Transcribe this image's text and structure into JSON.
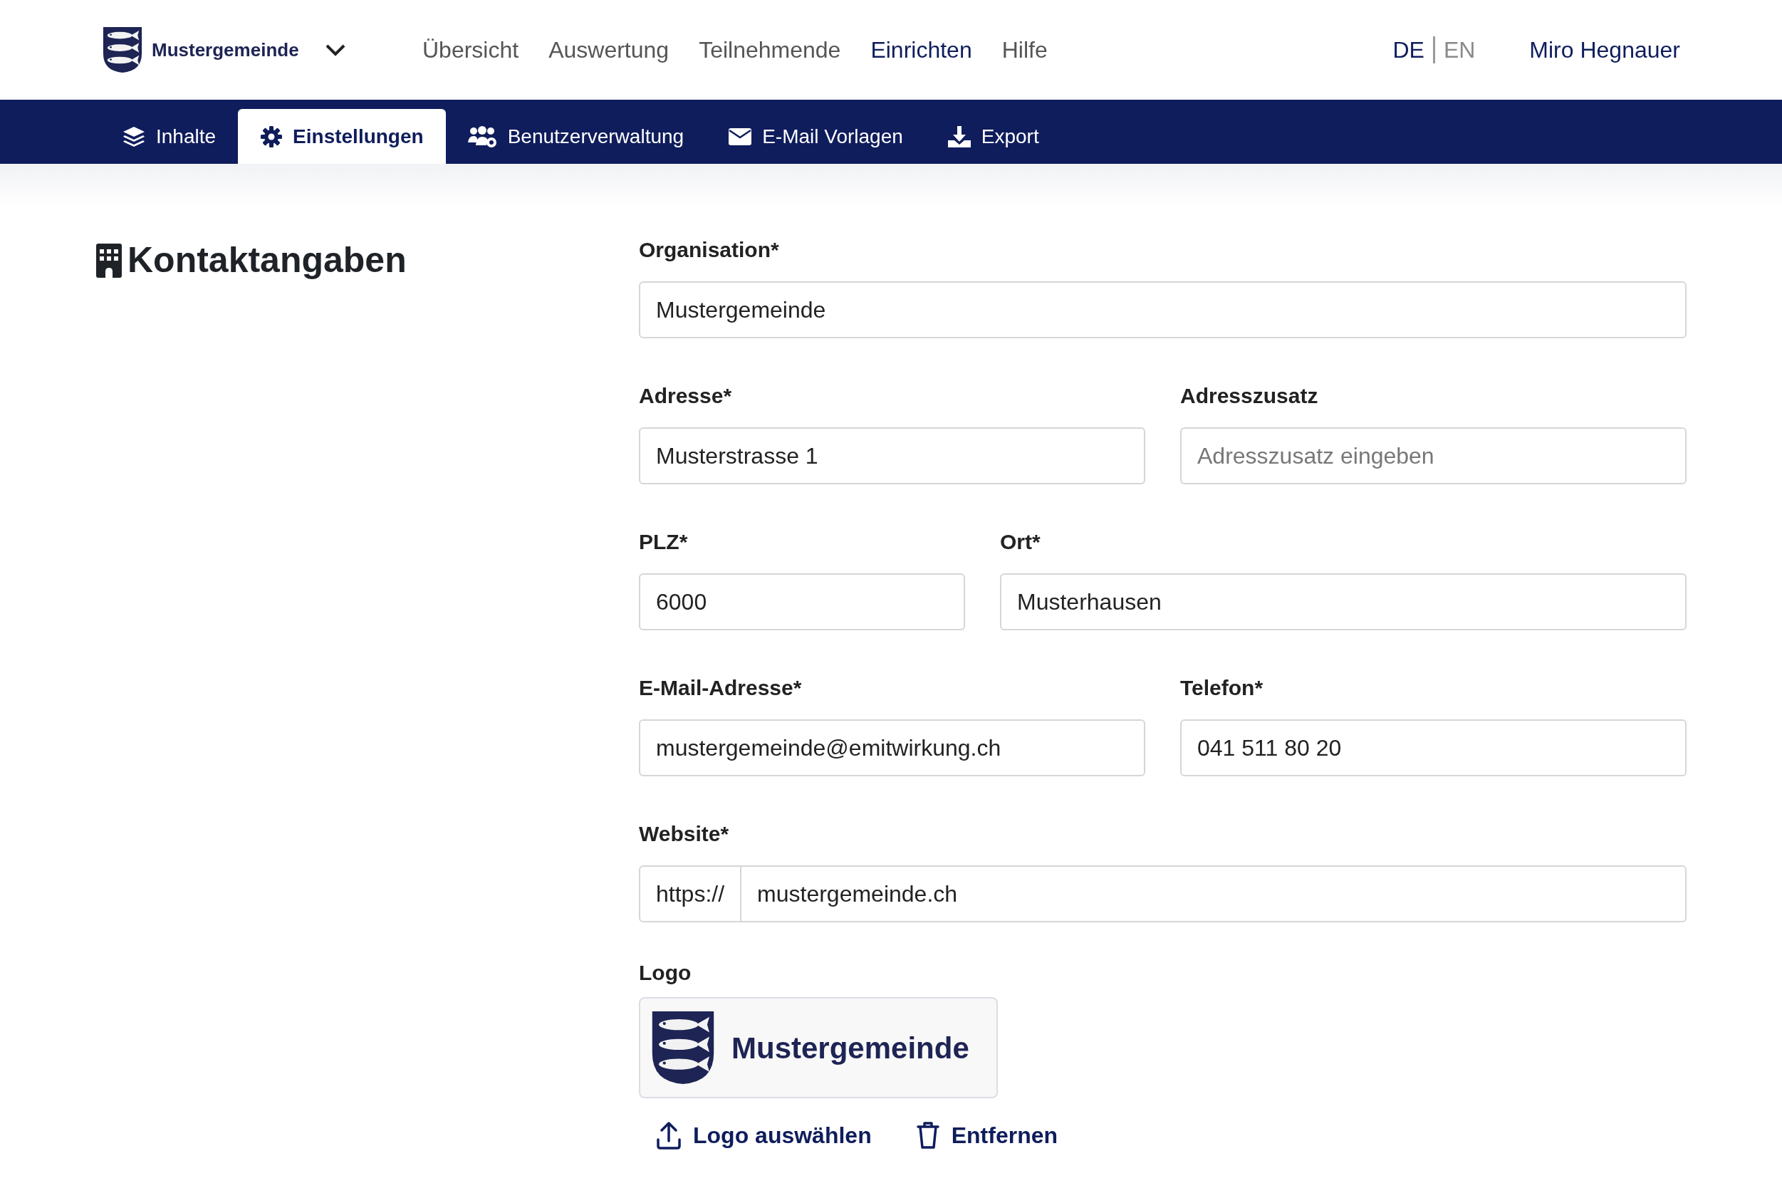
{
  "header": {
    "logo_text": "Mustergemeinde",
    "nav": [
      {
        "label": "Übersicht",
        "selected": false
      },
      {
        "label": "Auswertung",
        "selected": false
      },
      {
        "label": "Teilnehmende",
        "selected": false
      },
      {
        "label": "Einrichten",
        "selected": true
      },
      {
        "label": "Hilfe",
        "selected": false
      }
    ],
    "languages": [
      {
        "label": "DE",
        "selected": true
      },
      {
        "label": "EN",
        "selected": false
      }
    ],
    "user": "Miro Hegnauer"
  },
  "tabs": [
    {
      "label": "Inhalte",
      "selected": false
    },
    {
      "label": "Einstellungen",
      "selected": true
    },
    {
      "label": "Benutzerverwaltung",
      "selected": false
    },
    {
      "label": "E-Mail Vorlagen",
      "selected": false
    },
    {
      "label": "Export",
      "selected": false
    }
  ],
  "section": {
    "title": "Kontaktangaben"
  },
  "form_rows": [
    {
      "kind": "full",
      "fields": [
        {
          "label": "Organisation*",
          "value": "Mustergemeinde"
        }
      ]
    },
    {
      "kind": "halves",
      "fields": [
        {
          "label": "Adresse*",
          "value": "Musterstrasse 1"
        },
        {
          "label": "Adresszusatz",
          "placeholder": "Adresszusatz eingeben"
        }
      ]
    },
    {
      "kind": "narrow-wide",
      "fields": [
        {
          "label": "PLZ*",
          "value": "6000"
        },
        {
          "label": "Ort*",
          "value": "Musterhausen"
        }
      ]
    },
    {
      "kind": "halves",
      "fields": [
        {
          "label": "E-Mail-Adresse*",
          "value": "mustergemeinde@emitwirkung.ch"
        },
        {
          "label": "Telefon*",
          "value": "041 511 80 20"
        }
      ]
    },
    {
      "kind": "full",
      "fields": [
        {
          "label": "Website*",
          "prefix": "https://",
          "value": "mustergemeinde.ch"
        }
      ]
    }
  ],
  "logo": {
    "label": "Logo",
    "logo_text": "Mustergemeinde",
    "actions": [
      {
        "label": "Logo auswählen"
      },
      {
        "label": "Entfernen"
      }
    ]
  }
}
